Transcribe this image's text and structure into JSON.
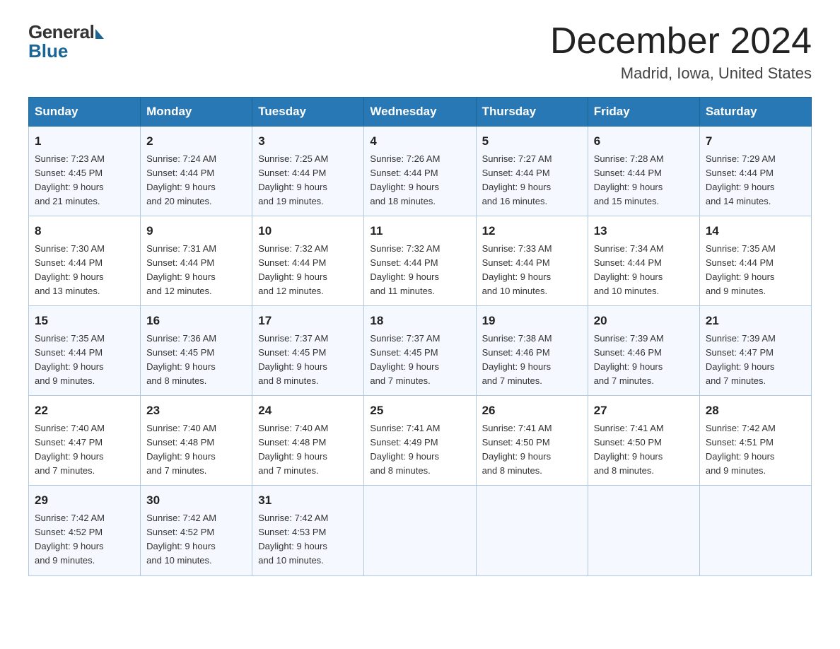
{
  "logo": {
    "general": "General",
    "blue": "Blue"
  },
  "title": {
    "month_year": "December 2024",
    "location": "Madrid, Iowa, United States"
  },
  "headers": [
    "Sunday",
    "Monday",
    "Tuesday",
    "Wednesday",
    "Thursday",
    "Friday",
    "Saturday"
  ],
  "weeks": [
    [
      {
        "day": "1",
        "sunrise": "7:23 AM",
        "sunset": "4:45 PM",
        "daylight": "9 hours and 21 minutes."
      },
      {
        "day": "2",
        "sunrise": "7:24 AM",
        "sunset": "4:44 PM",
        "daylight": "9 hours and 20 minutes."
      },
      {
        "day": "3",
        "sunrise": "7:25 AM",
        "sunset": "4:44 PM",
        "daylight": "9 hours and 19 minutes."
      },
      {
        "day": "4",
        "sunrise": "7:26 AM",
        "sunset": "4:44 PM",
        "daylight": "9 hours and 18 minutes."
      },
      {
        "day": "5",
        "sunrise": "7:27 AM",
        "sunset": "4:44 PM",
        "daylight": "9 hours and 16 minutes."
      },
      {
        "day": "6",
        "sunrise": "7:28 AM",
        "sunset": "4:44 PM",
        "daylight": "9 hours and 15 minutes."
      },
      {
        "day": "7",
        "sunrise": "7:29 AM",
        "sunset": "4:44 PM",
        "daylight": "9 hours and 14 minutes."
      }
    ],
    [
      {
        "day": "8",
        "sunrise": "7:30 AM",
        "sunset": "4:44 PM",
        "daylight": "9 hours and 13 minutes."
      },
      {
        "day": "9",
        "sunrise": "7:31 AM",
        "sunset": "4:44 PM",
        "daylight": "9 hours and 12 minutes."
      },
      {
        "day": "10",
        "sunrise": "7:32 AM",
        "sunset": "4:44 PM",
        "daylight": "9 hours and 12 minutes."
      },
      {
        "day": "11",
        "sunrise": "7:32 AM",
        "sunset": "4:44 PM",
        "daylight": "9 hours and 11 minutes."
      },
      {
        "day": "12",
        "sunrise": "7:33 AM",
        "sunset": "4:44 PM",
        "daylight": "9 hours and 10 minutes."
      },
      {
        "day": "13",
        "sunrise": "7:34 AM",
        "sunset": "4:44 PM",
        "daylight": "9 hours and 10 minutes."
      },
      {
        "day": "14",
        "sunrise": "7:35 AM",
        "sunset": "4:44 PM",
        "daylight": "9 hours and 9 minutes."
      }
    ],
    [
      {
        "day": "15",
        "sunrise": "7:35 AM",
        "sunset": "4:44 PM",
        "daylight": "9 hours and 9 minutes."
      },
      {
        "day": "16",
        "sunrise": "7:36 AM",
        "sunset": "4:45 PM",
        "daylight": "9 hours and 8 minutes."
      },
      {
        "day": "17",
        "sunrise": "7:37 AM",
        "sunset": "4:45 PM",
        "daylight": "9 hours and 8 minutes."
      },
      {
        "day": "18",
        "sunrise": "7:37 AM",
        "sunset": "4:45 PM",
        "daylight": "9 hours and 7 minutes."
      },
      {
        "day": "19",
        "sunrise": "7:38 AM",
        "sunset": "4:46 PM",
        "daylight": "9 hours and 7 minutes."
      },
      {
        "day": "20",
        "sunrise": "7:39 AM",
        "sunset": "4:46 PM",
        "daylight": "9 hours and 7 minutes."
      },
      {
        "day": "21",
        "sunrise": "7:39 AM",
        "sunset": "4:47 PM",
        "daylight": "9 hours and 7 minutes."
      }
    ],
    [
      {
        "day": "22",
        "sunrise": "7:40 AM",
        "sunset": "4:47 PM",
        "daylight": "9 hours and 7 minutes."
      },
      {
        "day": "23",
        "sunrise": "7:40 AM",
        "sunset": "4:48 PM",
        "daylight": "9 hours and 7 minutes."
      },
      {
        "day": "24",
        "sunrise": "7:40 AM",
        "sunset": "4:48 PM",
        "daylight": "9 hours and 7 minutes."
      },
      {
        "day": "25",
        "sunrise": "7:41 AM",
        "sunset": "4:49 PM",
        "daylight": "9 hours and 8 minutes."
      },
      {
        "day": "26",
        "sunrise": "7:41 AM",
        "sunset": "4:50 PM",
        "daylight": "9 hours and 8 minutes."
      },
      {
        "day": "27",
        "sunrise": "7:41 AM",
        "sunset": "4:50 PM",
        "daylight": "9 hours and 8 minutes."
      },
      {
        "day": "28",
        "sunrise": "7:42 AM",
        "sunset": "4:51 PM",
        "daylight": "9 hours and 9 minutes."
      }
    ],
    [
      {
        "day": "29",
        "sunrise": "7:42 AM",
        "sunset": "4:52 PM",
        "daylight": "9 hours and 9 minutes."
      },
      {
        "day": "30",
        "sunrise": "7:42 AM",
        "sunset": "4:52 PM",
        "daylight": "9 hours and 10 minutes."
      },
      {
        "day": "31",
        "sunrise": "7:42 AM",
        "sunset": "4:53 PM",
        "daylight": "9 hours and 10 minutes."
      },
      null,
      null,
      null,
      null
    ]
  ],
  "labels": {
    "sunrise": "Sunrise:",
    "sunset": "Sunset:",
    "daylight": "Daylight:"
  }
}
